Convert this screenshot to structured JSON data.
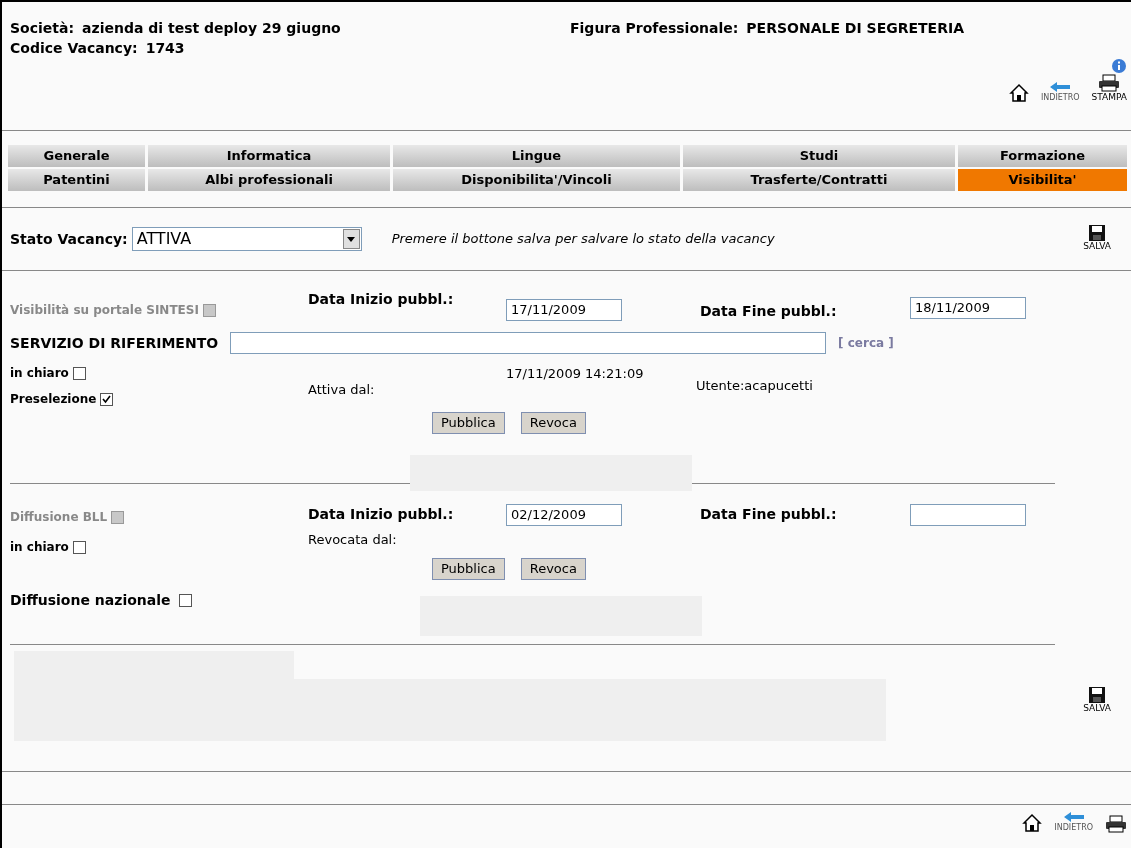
{
  "header": {
    "company_label": "Società:",
    "company": "azienda di test deploy 29 giugno",
    "code_label": "Codice Vacancy:",
    "code": "1743",
    "role_label": "Figura Professionale:",
    "role": "PERSONALE DI SEGRETERIA"
  },
  "toolbar": [
    {
      "kind": "home"
    },
    {
      "kind": "back",
      "label": "INDIETRO"
    },
    {
      "kind": "print",
      "label": "STAMPA"
    }
  ],
  "tabs": [
    [
      {
        "label": "Generale",
        "selected": false
      },
      {
        "label": "Informatica",
        "selected": false
      },
      {
        "label": "Lingue",
        "selected": false
      },
      {
        "label": "Studi",
        "selected": false
      },
      {
        "label": "Formazione",
        "selected": false
      }
    ],
    [
      {
        "label": "Patentini",
        "selected": false
      },
      {
        "label": "Albi professionali",
        "selected": false
      },
      {
        "label": "Disponibilita'/Vincoli",
        "selected": false
      },
      {
        "label": "Trasferte/Contratti",
        "selected": false
      },
      {
        "label": "Visibilita'",
        "selected": true
      }
    ]
  ],
  "stato": {
    "label": "Stato Vacancy:",
    "value": "ATTIVA",
    "note": "Premere il bottone salva per salvare lo stato della vacancy",
    "save": "SALVA"
  },
  "sintesi": {
    "checkbox": {
      "label": "Visibilità su portale SINTESI",
      "checked": false,
      "disabled": true
    },
    "start_label": "Data Inizio pubbl.:",
    "start": "17/11/2009",
    "end_label": "Data Fine pubbl.:",
    "end": "18/11/2009",
    "service_label": "SERVIZIO DI RIFERIMENTO",
    "search": "[ cerca ]",
    "options": [
      {
        "label": "in chiaro",
        "checked": false
      },
      {
        "label": "Preselezione",
        "checked": true
      }
    ],
    "since_label": "Attiva dal:",
    "timestamp": "17/11/2009 14:21:09",
    "user": "Utente:acapucetti",
    "buttons": [
      "Pubblica",
      "Revoca"
    ]
  },
  "bll": {
    "checkbox": {
      "label": "Diffusione BLL",
      "checked": false,
      "disabled": true
    },
    "start_label": "Data Inizio pubbl.:",
    "start": "02/12/2009",
    "end_label": "Data Fine pubbl.:",
    "option": {
      "label": "in chiaro",
      "checked": false
    },
    "since_label": "Revocata dal:",
    "buttons": [
      "Pubblica",
      "Revoca"
    ],
    "national": {
      "label": "Diffusione nazionale",
      "checked": false
    }
  },
  "save": "SALVA",
  "footer_toolbar": [
    {
      "kind": "home"
    },
    {
      "kind": "back",
      "label": "INDIETRO"
    },
    {
      "kind": "print"
    }
  ]
}
